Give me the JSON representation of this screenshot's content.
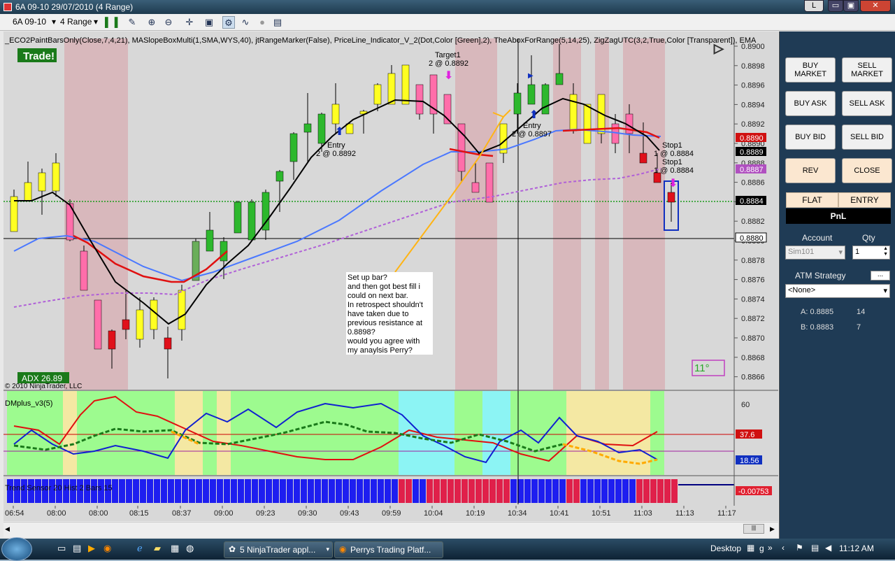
{
  "window": {
    "title": "6A 09-10  29/07/2010 (4 Range)",
    "minimize_label": "L"
  },
  "toolbar": {
    "instrument": "6A 09-10",
    "period": "4 Range"
  },
  "chart": {
    "indicator_line": "_ECO2PaintBarsOnly(Close,7,4,21), MASlopeBoxMulti(1,SMA,WYS,40), jtRangeMarker(False), PriceLine_Indicator_V_2(Dot,Color [Green],2), TheAboxForRange(5,14,25), ZigZagUTC(3,2,True,Color [Transparent]), EMA",
    "trade_badge": "Trade!",
    "adx": "ADX 26.89",
    "copyright": "© 2010 NinjaTrader, LLC",
    "angle_label": "11°",
    "target_label": "Target1",
    "target_value": "2 @ 0.8892",
    "entry1_label": "Entry",
    "entry1_value": "2 @ 0.8892",
    "entry2_label": "Entry",
    "entry2_value": "2 @ 0.8897",
    "stop1_label": "Stop1",
    "stop1_value": "1 @ 0.8884",
    "stop2_label": "Stop1",
    "stop2_value": "1 @ 0.8884",
    "note_lines": [
      "Set up bar?",
      "and then got best fill i",
      "could on next bar.",
      "In retrospect shouldn't",
      "have taken due to",
      "previous resistance at",
      "0.8898?",
      "would you agree with",
      "my anaylsis Perry?"
    ],
    "price_ticks": [
      "0.8900",
      "0.8898",
      "0.8896",
      "0.8894",
      "0.8892",
      "0.8890",
      "0.8888",
      "0.8886",
      "0.8884",
      "0.8882",
      "0.8880",
      "0.8878",
      "0.8876",
      "0.8874",
      "0.8872",
      "0.8870",
      "0.8868",
      "0.8866"
    ],
    "price_tags": [
      {
        "text": "0.8890",
        "color": "#d01010"
      },
      {
        "text": "0.8889",
        "color": "#000000"
      },
      {
        "text": "0.8887",
        "color": "#b050c0"
      },
      {
        "text": "0.8884",
        "color": "#000000"
      },
      {
        "text": "0.8880",
        "color": "#ffffff"
      }
    ],
    "dm_title": "DMplus_v3(5)",
    "dm_tick": "60",
    "dm_tags": [
      {
        "text": "37.6",
        "color": "#d01010"
      },
      {
        "text": "18.56",
        "color": "#1030c0"
      }
    ],
    "bottom_title": "Trend Sensor 20 Hist 2 Bars 15",
    "bottom_tag": "-0.00753",
    "time_ticks": [
      "06:54",
      "08:00",
      "08:00",
      "08:15",
      "08:37",
      "09:00",
      "09:23",
      "09:30",
      "09:43",
      "09:59",
      "10:04",
      "10:19",
      "10:34",
      "10:41",
      "10:51",
      "11:03",
      "11:13",
      "11:17"
    ]
  },
  "order_panel": {
    "buttons": [
      [
        "BUY MARKET",
        "SELL MARKET"
      ],
      [
        "BUY ASK",
        "SELL ASK"
      ],
      [
        "BUY BID",
        "SELL BID"
      ],
      [
        "REV",
        "CLOSE"
      ]
    ],
    "flat": "FLAT",
    "entry": "ENTRY",
    "pnl": "PnL",
    "account_label": "Account",
    "qty_label": "Qty",
    "account_value": "Sim101",
    "qty_value": "1",
    "atm_label": "ATM Strategy",
    "atm_value": "<None>",
    "atm_btn": "...",
    "ask_label": "A: 0.8885",
    "ask_size": "14",
    "bid_label": "B: 0.8883",
    "bid_size": "7"
  },
  "taskbar": {
    "tasks": [
      "5 NinjaTrader appl...",
      "Perrys Trading Platf..."
    ],
    "desktop_label": "Desktop",
    "g_label": "g",
    "clock": "11:12 AM"
  }
}
